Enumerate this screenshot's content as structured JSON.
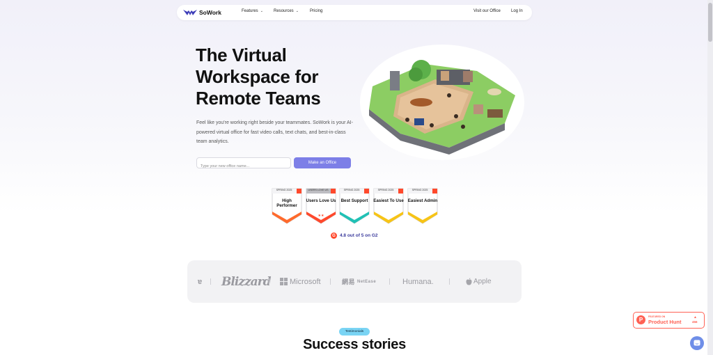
{
  "nav": {
    "brand": "SoWork",
    "items": [
      {
        "label": "Features",
        "has_dropdown": true
      },
      {
        "label": "Resources",
        "has_dropdown": true
      },
      {
        "label": "Pricing",
        "has_dropdown": false
      }
    ],
    "visit_office": "Visit our Office",
    "login": "Log In"
  },
  "hero": {
    "title": "The Virtual Workspace for Remote Teams",
    "subtitle": "Feel like you're working right beside your teammates. SoWork is your AI-powered virtual office for fast video calls, text chats, and best-in-class team analytics.",
    "input_placeholder": "Type your new office name...",
    "cta": "Make an Office"
  },
  "badges": [
    {
      "season": "SPRING 2025",
      "label": "High Performer",
      "accent": "#ff6a2c"
    },
    {
      "season": "USERS LOVE US",
      "label": "Users Love Us",
      "accent": "#ff492c"
    },
    {
      "season": "SPRING 2025",
      "label": "Best Support",
      "accent": "#20c1b5"
    },
    {
      "season": "SPRING 2025",
      "label": "Easiest To Use",
      "accent": "#f7c416"
    },
    {
      "season": "SPRING 2025",
      "label": "Easiest Admin",
      "accent": "#f7c416"
    }
  ],
  "rating": {
    "icon": "g2-icon",
    "text": "4.8 out of 5 on G2"
  },
  "logos": [
    "Blizzard",
    "Microsoft",
    "NetEase",
    "Humana.",
    "Apple"
  ],
  "testimonials": {
    "pill": "Testimonials",
    "title": "Success stories"
  },
  "product_hunt": {
    "featured": "FEATURED ON",
    "name": "Product Hunt",
    "count": "456"
  },
  "colors": {
    "accent": "#7d7fe7",
    "product_hunt": "#ff6154",
    "pill": "#7ad4f4"
  }
}
